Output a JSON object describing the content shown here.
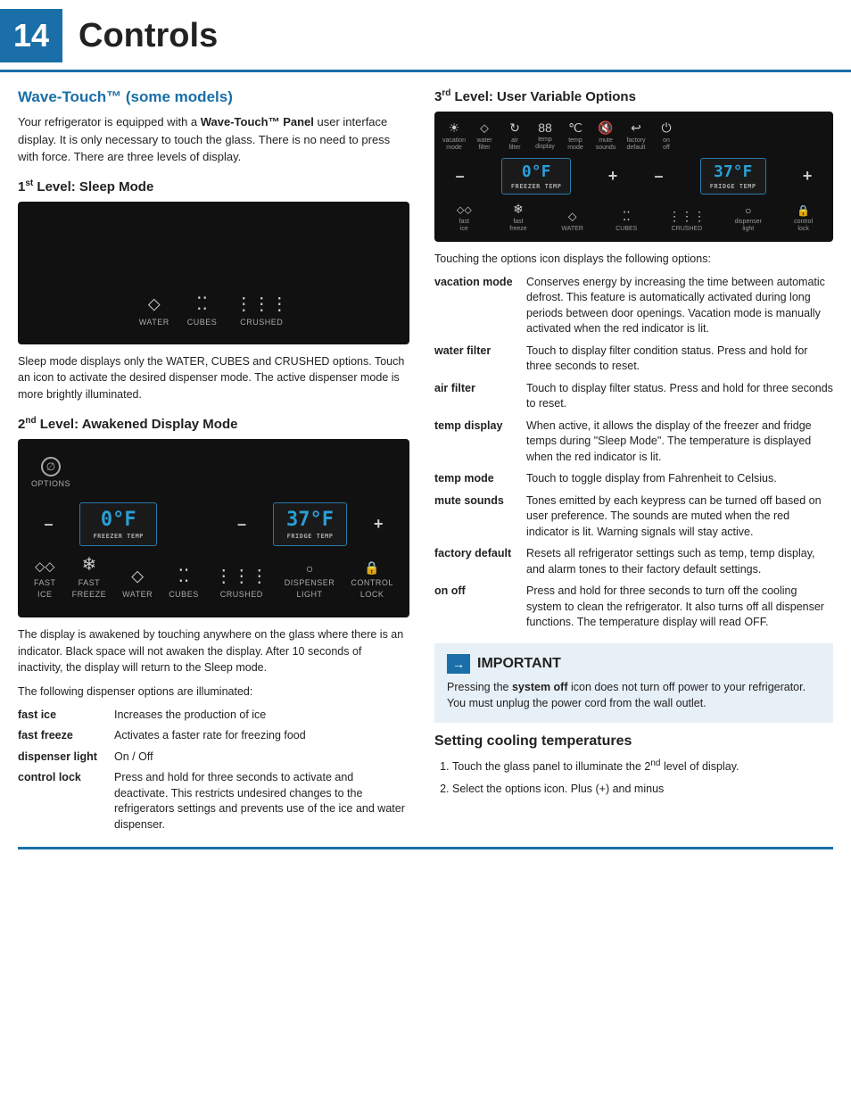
{
  "header": {
    "page_number": "14",
    "title": "Controls"
  },
  "left": {
    "section_heading": "Wave-Touch™ (some models)",
    "intro": "Your refrigerator is equipped with a Wave-Touch™ Panel user interface display. It is only necessary to touch the glass. There is no need to press with force. There are three levels of display.",
    "level1_heading": "1st Level: Sleep Mode",
    "sleep_desc": "Sleep mode displays only the WATER, CUBES and CRUSHED options. Touch an icon to activate the desired dispenser mode. The active dispenser mode is more brightly illuminated.",
    "level2_heading": "2nd Level: Awakened Display Mode",
    "awakened_desc1": "The display is awakened by touching anywhere on the glass where there is an indicator. Black space will not awaken the display. After 10 seconds of inactivity, the display will return to the Sleep mode.",
    "awakened_desc2": "The following dispenser options are illuminated:",
    "dispenser_items": [
      {
        "term": "fast ice",
        "def": "Increases the production of ice"
      },
      {
        "term": "fast freeze",
        "def": "Activates a faster rate for freezing food"
      },
      {
        "term": "dispenser light",
        "def": "On / Off"
      },
      {
        "term": "control lock",
        "def": "Press and hold for three seconds to activate and deactivate. This restricts undesired changes to the refrigerators settings and prevents use of the ice and water dispenser."
      }
    ],
    "sleep_icons": [
      {
        "sym": "♦",
        "label": "WATER"
      },
      {
        "sym": "⁘⁘",
        "label": "CUBES"
      },
      {
        "sym": "⁙⁙⁙",
        "label": "CRUSHED"
      }
    ],
    "freezer_temp": "0°F",
    "fridge_temp": "37°F",
    "freezer_label": "FREEZER TEMP",
    "fridge_label": "FRIDGE TEMP"
  },
  "right": {
    "level3_heading": "3rd Level: User Variable Options",
    "touch_desc": "Touching the options icon displays the following options:",
    "options": [
      {
        "term": "vacation mode",
        "def": "Conserves energy by increasing the time between automatic defrost. This feature is automatically activated during long periods between door openings. Vacation mode is manually activated when the red indicator is lit."
      },
      {
        "term": "water filter",
        "def": "Touch to display filter condition status. Press and hold for three seconds to reset."
      },
      {
        "term": "air filter",
        "def": "Touch to display filter status. Press and hold for three seconds to reset."
      },
      {
        "term": "temp display",
        "def": "When active, it allows the display of the freezer and fridge temps during \"Sleep Mode\". The temperature is displayed when the red indicator is lit."
      },
      {
        "term": "temp mode",
        "def": "Touch to toggle display from Fahrenheit to Celsius."
      },
      {
        "term": "mute sounds",
        "def": "Tones emitted by each keypress can be turned off based on user preference. The sounds are muted when the red indicator is lit. Warning signals will stay active."
      },
      {
        "term": "factory default",
        "def": "Resets all refrigerator settings such as temp, temp display, and alarm tones to their factory default settings."
      },
      {
        "term": "on off",
        "def": "Press and hold for three seconds to turn off the cooling system  to clean the refrigerator. It also turns off all dispenser functions. The temperature display will read OFF."
      }
    ],
    "important_heading": "IMPORTANT",
    "important_text": "Pressing the system off icon does not turn off power to your refrigerator. You must unplug the power cord from the wall outlet.",
    "cooling_heading": "Setting cooling temperatures",
    "cooling_steps": [
      "Touch the glass panel to illuminate the 2nd level of display.",
      "Select the options icon. Plus (+) and minus"
    ],
    "third_icons_top": [
      {
        "sym": "☀",
        "label": "vacation\nmode"
      },
      {
        "sym": "🜄",
        "label": "water\nfilter"
      },
      {
        "sym": "↻",
        "label": "air\nfilter"
      },
      {
        "sym": "88",
        "label": "temp\ndisplay"
      },
      {
        "sym": "℃",
        "label": "temp\nmode"
      },
      {
        "sym": "🔇",
        "label": "mute\nsounds"
      },
      {
        "sym": "↩",
        "label": "factory\ndefault"
      },
      {
        "sym": "⏻",
        "label": "on\noff"
      }
    ],
    "third_icons_bot": [
      {
        "sym": "🧊",
        "label": "fast\nice"
      },
      {
        "sym": "❄",
        "label": "fast\nfreeze"
      },
      {
        "sym": "♦",
        "label": "WATER"
      },
      {
        "sym": "⁘⁘",
        "label": "CUBES"
      },
      {
        "sym": "⁙⁙⁙",
        "label": "CRUSHED"
      },
      {
        "sym": "💡",
        "label": "dispenser\nlight"
      },
      {
        "sym": "🔒",
        "label": "control\nlock"
      }
    ]
  }
}
